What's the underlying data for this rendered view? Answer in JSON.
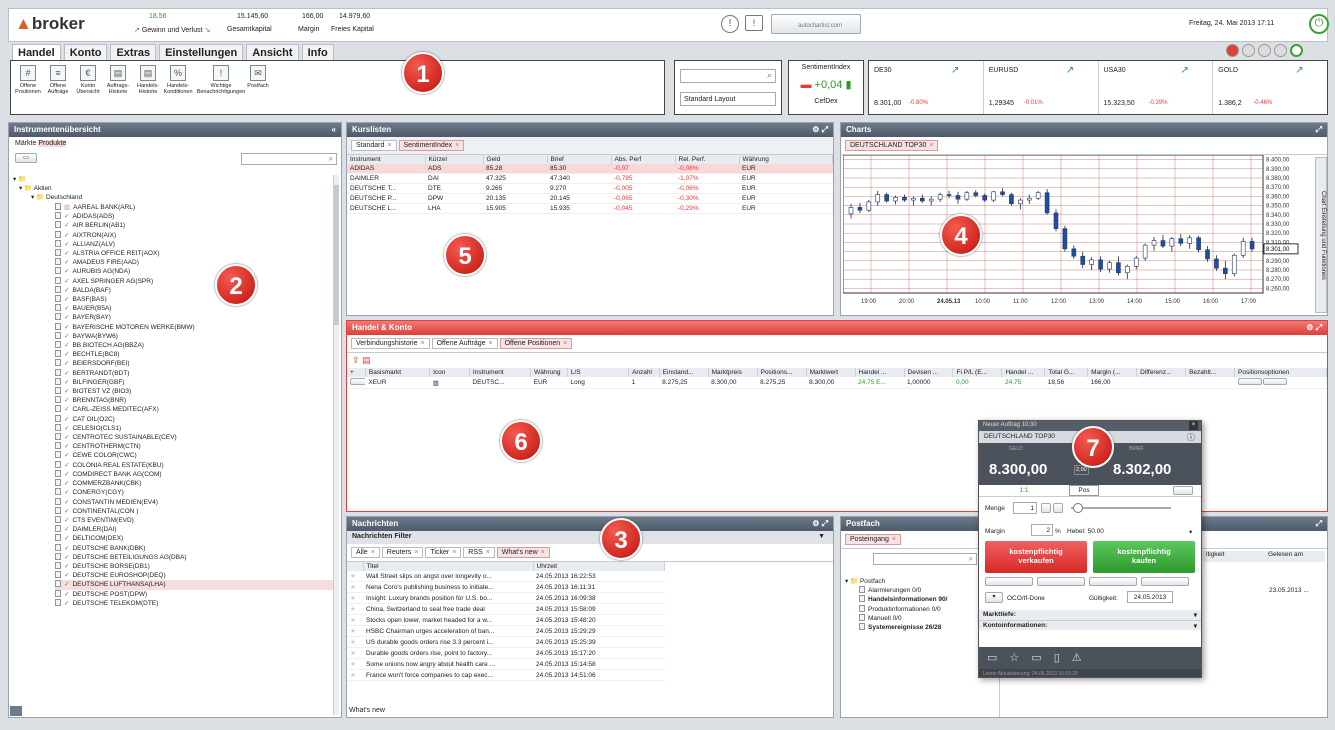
{
  "header": {
    "logo": "broker",
    "gewinn_value": "18,56",
    "gewinn_label": "Gewinn und Verlust",
    "gesamtkapital_value": "15.145,60",
    "gesamtkapital_label": "Gesamtkapital",
    "margin_value": "166,00",
    "margin_label": "Margin",
    "freies_value": "14.979,60",
    "freies_label": "Freies Kapital",
    "datetime": "Freitag, 24. Mai 2013 17:11",
    "search_field": "autochartist.com"
  },
  "menu": {
    "tabs": [
      "Handel",
      "Konto",
      "Extras",
      "Einstellungen",
      "Ansicht",
      "Info"
    ]
  },
  "ribbon": {
    "buttons": [
      {
        "label": "Offene Positionen",
        "icon": "#"
      },
      {
        "label": "Offene Aufträge",
        "icon": "≡"
      },
      {
        "label": "Konto Übersicht",
        "icon": "€"
      },
      {
        "label": "Auftrags-Historie",
        "icon": "▤"
      },
      {
        "label": "Handels-Historie",
        "icon": "▤"
      },
      {
        "label": "Handels-Konditionen",
        "icon": "%"
      },
      {
        "label": "Wichtige Benachrichtigungen",
        "icon": "!"
      },
      {
        "label": "Postfach",
        "icon": "✉"
      }
    ],
    "layout_value": "Standard Layout",
    "sentiment_title": "SentimentIndex",
    "sentiment_value": "+0,04",
    "sentiment_instrument": "CefDex"
  },
  "tickers": [
    {
      "name": "DE30",
      "price": "8.301,00",
      "change": "-0.80%"
    },
    {
      "name": "EURUSD",
      "price": "1,29345",
      "change": "-0.01%"
    },
    {
      "name": "USA30",
      "price": "15.323,50",
      "change": "-0.39%"
    },
    {
      "name": "GOLD",
      "price": "1.386,2",
      "change": "-0.46%"
    }
  ],
  "instruments": {
    "title": "Instrumentenübersicht",
    "tabs": [
      "Märkte",
      "Produkte"
    ],
    "root": "Aktien",
    "country": "Deutschland",
    "items": [
      "AAREAL BANK(ARL)",
      "ADIDAS(ADS)",
      "AIR BERLIN(AB1)",
      "AIXTRON(AIX)",
      "ALLIANZ(ALV)",
      "ALSTRIA OFFICE REIT(AOX)",
      "AMADEUS FIRE(AAD)",
      "AURUBIS AG(NDA)",
      "AXEL SPRINGER AG(SPR)",
      "BALDA(BAF)",
      "BASF(BAS)",
      "BAUER(B5A)",
      "BAYER(BAY)",
      "BAYERISCHE MOTOREN WERKE(BMW)",
      "BAYWA(BYW6)",
      "BB BIOTECH AG(BBZA)",
      "BECHTLE(BC8)",
      "BEIERSDORF(BEI)",
      "BERTRANDT(BDT)",
      "BILFINGER(GBF)",
      "BIOTEST VZ (BIO3)",
      "BRENNTAG(BNR)",
      "CARL-ZEISS MEDITEC(AFX)",
      "CAT OIL(O2C)",
      "CELESIO(CLS1)",
      "CENTROTEC SUSTAINABLE(CEV)",
      "CENTROTHERM(CTN)",
      "CEWE COLOR(CWC)",
      "COLONIA REAL ESTATE(KBU)",
      "COMDIRECT BANK AG(COM)",
      "COMMERZBANK(CBK)",
      "CONERGY(CGY)",
      "CONSTANTIN MEDIEN(EV4)",
      "CONTINENTAL(CON )",
      "CTS EVENTIM(EVD)",
      "DAIMLER(DAI)",
      "DELTICOM(DEX)",
      "DEUTSCHE BANK(DBK)",
      "DEUTSCHE BETEILIGUNGS AG(DBA)",
      "DEUTSCHE BORSE(DB1)",
      "DEUTSCHE EUROSHOP(DEQ)",
      "DEUTSCHE LUFTHANSA(LHA)",
      "DEUTSCHE POST(DPW)",
      "DEUTSCHE TELEKOM(DTE)"
    ]
  },
  "kurslisten": {
    "title": "Kurslisten",
    "tabs": [
      "Standard",
      "SentimentIndex"
    ],
    "columns": [
      "Instrument",
      "Kürzel",
      "Geld",
      "Brief",
      "Abs. Perf",
      "Rel. Perf.",
      "Währung"
    ],
    "rows": [
      [
        "ADIDAS",
        "ADS",
        "85.28",
        "85.30",
        "-0,07",
        "-0,08%",
        "EUR"
      ],
      [
        "DAIMLER",
        "DAI",
        "47.325",
        "47.340",
        "-0,785",
        "-1,07%",
        "EUR"
      ],
      [
        "DEUTSCHE T...",
        "DTE",
        "9.265",
        "9.270",
        "-0,005",
        "-0,06%",
        "EUR"
      ],
      [
        "DEUTSCHE P...",
        "DPW",
        "20.135",
        "20.145",
        "-0,065",
        "-0,30%",
        "EUR"
      ],
      [
        "DEUTSCHE L...",
        "LHA",
        "15.905",
        "15.935",
        "-0,045",
        "-0,29%",
        "EUR"
      ]
    ]
  },
  "chart": {
    "title": "Charts",
    "tab": "DEUTSCHLAND TOP30",
    "side_label": "Chart Einstellung und Funktionen",
    "current_price": "8.301,00"
  },
  "chart_data": {
    "type": "candlestick",
    "xlabel_ticks": [
      "19:00",
      "20:00",
      "24.05.13",
      "10:00",
      "11:00",
      "12:00",
      "13:00",
      "14:00",
      "15:00",
      "16:00",
      "17:00"
    ],
    "y_ticks": [
      "8.400,00",
      "8.390,00",
      "8.380,00",
      "8.370,00",
      "8.360,00",
      "8.350,00",
      "8.340,00",
      "8.330,00",
      "8.320,00",
      "8.310,00",
      "8.300,00",
      "8.290,00",
      "8.280,00",
      "8.270,00",
      "8.260,00"
    ],
    "ylim": [
      8255,
      8405
    ],
    "ohlc": [
      [
        8341,
        8352,
        8336,
        8348
      ],
      [
        8348,
        8353,
        8342,
        8345
      ],
      [
        8345,
        8356,
        8343,
        8354
      ],
      [
        8354,
        8366,
        8350,
        8362
      ],
      [
        8362,
        8364,
        8353,
        8355
      ],
      [
        8355,
        8361,
        8351,
        8359
      ],
      [
        8359,
        8362,
        8354,
        8356
      ],
      [
        8356,
        8360,
        8350,
        8358
      ],
      [
        8358,
        8362,
        8353,
        8355
      ],
      [
        8355,
        8360,
        8350,
        8357
      ],
      [
        8357,
        8364,
        8354,
        8362
      ],
      [
        8362,
        8366,
        8358,
        8361
      ],
      [
        8361,
        8365,
        8352,
        8357
      ],
      [
        8357,
        8366,
        8355,
        8364
      ],
      [
        8364,
        8367,
        8359,
        8361
      ],
      [
        8361,
        8363,
        8354,
        8356
      ],
      [
        8356,
        8366,
        8354,
        8365
      ],
      [
        8365,
        8369,
        8360,
        8362
      ],
      [
        8362,
        8364,
        8350,
        8352
      ],
      [
        8352,
        8358,
        8346,
        8356
      ],
      [
        8356,
        8362,
        8352,
        8358
      ],
      [
        8358,
        8366,
        8356,
        8364
      ],
      [
        8364,
        8368,
        8340,
        8342
      ],
      [
        8342,
        8346,
        8322,
        8325
      ],
      [
        8325,
        8328,
        8300,
        8303
      ],
      [
        8303,
        8307,
        8292,
        8295
      ],
      [
        8295,
        8300,
        8282,
        8286
      ],
      [
        8286,
        8294,
        8280,
        8291
      ],
      [
        8291,
        8295,
        8278,
        8281
      ],
      [
        8281,
        8290,
        8277,
        8288
      ],
      [
        8288,
        8295,
        8274,
        8277
      ],
      [
        8277,
        8286,
        8270,
        8284
      ],
      [
        8284,
        8295,
        8281,
        8293
      ],
      [
        8293,
        8309,
        8290,
        8307
      ],
      [
        8307,
        8316,
        8301,
        8312
      ],
      [
        8312,
        8318,
        8304,
        8306
      ],
      [
        8306,
        8316,
        8300,
        8314
      ],
      [
        8314,
        8319,
        8306,
        8309
      ],
      [
        8309,
        8318,
        8303,
        8315
      ],
      [
        8315,
        8317,
        8299,
        8302
      ],
      [
        8302,
        8306,
        8289,
        8292
      ],
      [
        8292,
        8296,
        8279,
        8282
      ],
      [
        8282,
        8290,
        8270,
        8276
      ],
      [
        8276,
        8298,
        8273,
        8296
      ],
      [
        8296,
        8315,
        8293,
        8311
      ],
      [
        8311,
        8315,
        8300,
        8303
      ]
    ]
  },
  "handel": {
    "title": "Handel & Konto",
    "tabs": [
      "Verbindungshistorie",
      "Offene Aufträge",
      "Offene Positionen"
    ],
    "columns": [
      "Basismarkt",
      "Icon",
      "Instrument",
      "Währung",
      "L/S",
      "Anzahl",
      "Einstand...",
      "Marktpreis",
      "Positions...",
      "Marktwert",
      "Handel ...",
      "Devisen ...",
      "Fi P/L (E...",
      "Handel ...",
      "Total G...",
      "Margin (...",
      "Differenz...",
      "Bezahlt...",
      "Positionsoptionen"
    ],
    "row": [
      "XEUR",
      "",
      "DEUTSC...",
      "EUR",
      "Long",
      "1",
      "8.275,25",
      "8.300,00",
      "8.275,25",
      "8.300,00",
      "24,75 E...",
      "1,00000",
      "0,00",
      "24,75",
      "18,56",
      "166,00",
      "",
      "",
      ""
    ]
  },
  "nachrichten": {
    "title": "Nachrichten",
    "filter": "Nachrichten Filter",
    "tabs": [
      "Alle",
      "Reuters",
      "Ticker",
      "RSS",
      "What's new"
    ],
    "col_title": "Titel",
    "col_time": "Uhrzeit",
    "footer": "What's new",
    "items": [
      [
        "Wall Street slips on angst over longevity o...",
        "24.05.2013 16:22:53"
      ],
      [
        "Nena Coro's publishing business to initiate...",
        "24.05.2013 16:11:31"
      ],
      [
        "Insight: Luxury brands position for U.S. bo...",
        "24.05.2013 16:09:38"
      ],
      [
        "China, Switzerland to seal free trade deal",
        "24.05.2013 15:58:09"
      ],
      [
        "Stocks open lower, market headed for a w...",
        "24.05.2013 15:48:20"
      ],
      [
        "HSBC Chairman urges acceleration of ban...",
        "24.05.2013 15:29:29"
      ],
      [
        "US durable goods orders rise 3.3 percent i...",
        "24.05.2013 15:25:39"
      ],
      [
        "Durable goods orders rise, point to factory...",
        "24.05.2013 15:17:20"
      ],
      [
        "Some unions now angry about health care ...",
        "24.05.2013 15:14:58"
      ],
      [
        "France won't force companies to cap exec...",
        "24.05.2013 14:51:06"
      ]
    ]
  },
  "postfach": {
    "title": "Postfach",
    "tab": "Posteingang",
    "root": "Postfach",
    "items": [
      "Alarmierungen 0/0",
      "Handelsinformationen 90/",
      "Produktinformationen 0/0",
      "Manuell 0/0",
      "Systemereignisse 26/28"
    ],
    "col1": "Gelesen am",
    "col0": "itigkeit",
    "date": "23.05.2013 ..."
  },
  "order": {
    "title": "Neuer Auftrag 10:30",
    "instrument": "DEUTSCHLAND TOP30",
    "geld_label": "GELD",
    "brief_label": "BRIEF",
    "geld": "8.300,00",
    "brief": "8.302,00",
    "spread": "2,00",
    "tab1": "1:1",
    "tab2": "Pos",
    "menge_label": "Menge",
    "menge": "1",
    "margin_label": "Margin",
    "margin": "2",
    "hebel": "Hebel: 50.00",
    "sell_label": "kostenpflichtig verkaufen",
    "buy_label": "kostenpflichtig kaufen",
    "oco": "OCO/If-Done",
    "gueltig_label": "Gültigkeit:",
    "gueltig": "24.05.2013",
    "markttiefe": "Markttiefe:",
    "kontoinfo": "Kontoinformationen:",
    "status": "Letzte Aktualisierung: 24.05.2013 16:51:20"
  },
  "badges": [
    "1",
    "2",
    "3",
    "4",
    "5",
    "6",
    "7"
  ]
}
